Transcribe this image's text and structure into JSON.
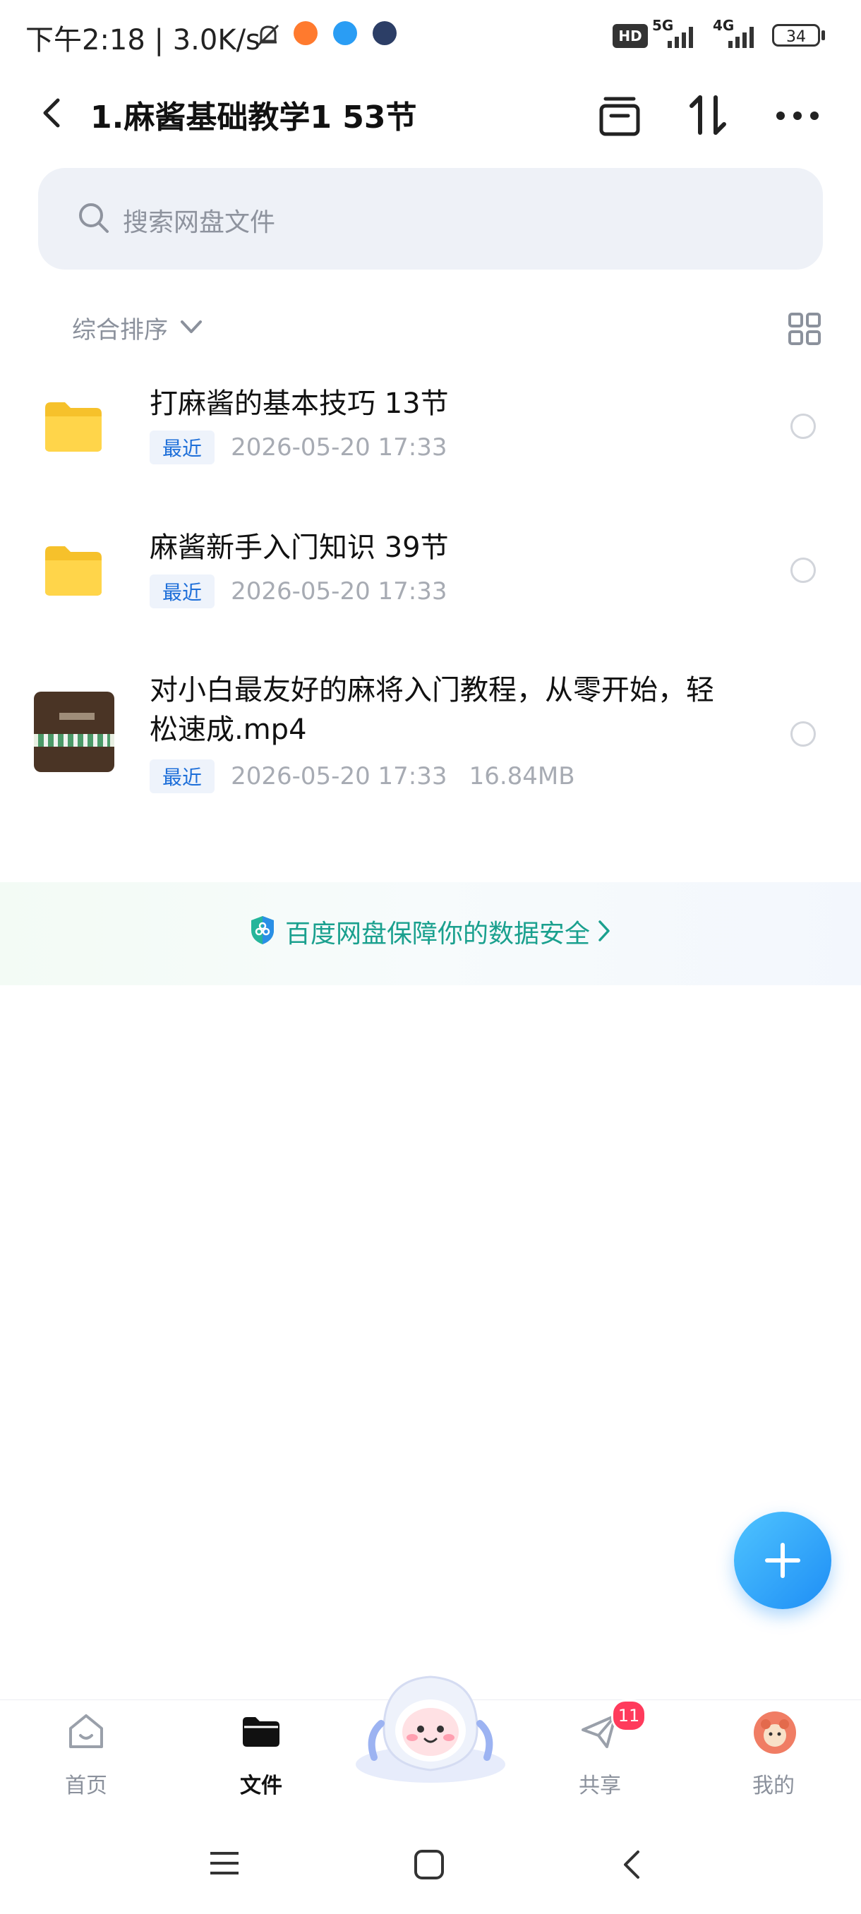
{
  "status_bar": {
    "time": "下午2:18 | 3.0K/s",
    "hd": "HD",
    "net1": "5G",
    "net2": "4G",
    "battery": "34"
  },
  "header": {
    "title": "1.麻酱基础教学1  53节"
  },
  "search": {
    "placeholder": "搜索网盘文件"
  },
  "sort": {
    "label": "综合排序"
  },
  "files": [
    {
      "name": "打麻酱的基本技巧 13节",
      "badge": "最近",
      "date": "2026-05-20  17:33",
      "size": ""
    },
    {
      "name": "麻酱新手入门知识 39节",
      "badge": "最近",
      "date": "2026-05-20  17:33",
      "size": ""
    },
    {
      "name_line1": "对小白最友好的麻将入门教程，从零开始，轻",
      "name_line2": "松速成.mp4",
      "badge": "最近",
      "date": "2026-05-20  17:33",
      "size": "16.84MB"
    }
  ],
  "banner": {
    "text": "百度网盘保障你的数据安全"
  },
  "tabs": [
    {
      "label": "首页"
    },
    {
      "label": "文件"
    },
    {
      "label": "共享",
      "badge": "11"
    },
    {
      "label": "我的"
    }
  ],
  "colors": {
    "accent": "#1e8ef5",
    "badge_red": "#ff3b5c",
    "banner_text": "#1aa08e"
  }
}
